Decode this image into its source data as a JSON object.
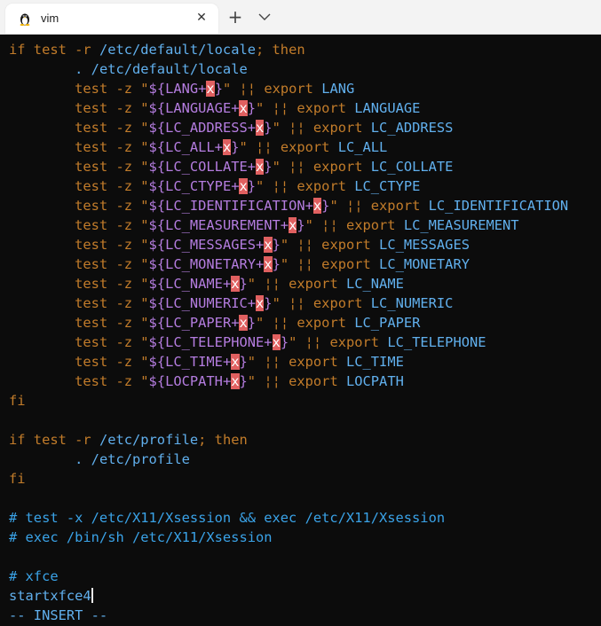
{
  "tab": {
    "title": "vim",
    "icon": "linux-tux-icon",
    "close": "✕",
    "new": "+"
  },
  "lines": [
    [
      [
        "kw",
        "if test -r "
      ],
      [
        "id",
        "/etc/default/locale"
      ],
      [
        "kw",
        "; then"
      ]
    ],
    [
      [
        "pl",
        "        "
      ],
      [
        "id",
        ". /etc/default/locale"
      ]
    ],
    [
      [
        "pl",
        "        "
      ],
      [
        "kw",
        "test -z \""
      ],
      [
        "var",
        "${LANG+"
      ],
      [
        "hl",
        "x"
      ],
      [
        "var",
        "}"
      ],
      [
        "kw",
        "\" ¦¦ export "
      ],
      [
        "id",
        "LANG"
      ]
    ],
    [
      [
        "pl",
        "        "
      ],
      [
        "kw",
        "test -z \""
      ],
      [
        "var",
        "${LANGUAGE+"
      ],
      [
        "hl",
        "x"
      ],
      [
        "var",
        "}"
      ],
      [
        "kw",
        "\" ¦¦ export "
      ],
      [
        "id",
        "LANGUAGE"
      ]
    ],
    [
      [
        "pl",
        "        "
      ],
      [
        "kw",
        "test -z \""
      ],
      [
        "var",
        "${LC_ADDRESS+"
      ],
      [
        "hl",
        "x"
      ],
      [
        "var",
        "}"
      ],
      [
        "kw",
        "\" ¦¦ export "
      ],
      [
        "id",
        "LC_ADDRESS"
      ]
    ],
    [
      [
        "pl",
        "        "
      ],
      [
        "kw",
        "test -z \""
      ],
      [
        "var",
        "${LC_ALL+"
      ],
      [
        "hl",
        "x"
      ],
      [
        "var",
        "}"
      ],
      [
        "kw",
        "\" ¦¦ export "
      ],
      [
        "id",
        "LC_ALL"
      ]
    ],
    [
      [
        "pl",
        "        "
      ],
      [
        "kw",
        "test -z \""
      ],
      [
        "var",
        "${LC_COLLATE+"
      ],
      [
        "hl",
        "x"
      ],
      [
        "var",
        "}"
      ],
      [
        "kw",
        "\" ¦¦ export "
      ],
      [
        "id",
        "LC_COLLATE"
      ]
    ],
    [
      [
        "pl",
        "        "
      ],
      [
        "kw",
        "test -z \""
      ],
      [
        "var",
        "${LC_CTYPE+"
      ],
      [
        "hl",
        "x"
      ],
      [
        "var",
        "}"
      ],
      [
        "kw",
        "\" ¦¦ export "
      ],
      [
        "id",
        "LC_CTYPE"
      ]
    ],
    [
      [
        "pl",
        "        "
      ],
      [
        "kw",
        "test -z \""
      ],
      [
        "var",
        "${LC_IDENTIFICATION+"
      ],
      [
        "hl",
        "x"
      ],
      [
        "var",
        "}"
      ],
      [
        "kw",
        "\" ¦¦ export "
      ],
      [
        "id",
        "LC_IDENTIFICATION"
      ]
    ],
    [
      [
        "pl",
        "        "
      ],
      [
        "kw",
        "test -z \""
      ],
      [
        "var",
        "${LC_MEASUREMENT+"
      ],
      [
        "hl",
        "x"
      ],
      [
        "var",
        "}"
      ],
      [
        "kw",
        "\" ¦¦ export "
      ],
      [
        "id",
        "LC_MEASUREMENT"
      ]
    ],
    [
      [
        "pl",
        "        "
      ],
      [
        "kw",
        "test -z \""
      ],
      [
        "var",
        "${LC_MESSAGES+"
      ],
      [
        "hl",
        "x"
      ],
      [
        "var",
        "}"
      ],
      [
        "kw",
        "\" ¦¦ export "
      ],
      [
        "id",
        "LC_MESSAGES"
      ]
    ],
    [
      [
        "pl",
        "        "
      ],
      [
        "kw",
        "test -z \""
      ],
      [
        "var",
        "${LC_MONETARY+"
      ],
      [
        "hl",
        "x"
      ],
      [
        "var",
        "}"
      ],
      [
        "kw",
        "\" ¦¦ export "
      ],
      [
        "id",
        "LC_MONETARY"
      ]
    ],
    [
      [
        "pl",
        "        "
      ],
      [
        "kw",
        "test -z \""
      ],
      [
        "var",
        "${LC_NAME+"
      ],
      [
        "hl",
        "x"
      ],
      [
        "var",
        "}"
      ],
      [
        "kw",
        "\" ¦¦ export "
      ],
      [
        "id",
        "LC_NAME"
      ]
    ],
    [
      [
        "pl",
        "        "
      ],
      [
        "kw",
        "test -z \""
      ],
      [
        "var",
        "${LC_NUMERIC+"
      ],
      [
        "hl",
        "x"
      ],
      [
        "var",
        "}"
      ],
      [
        "kw",
        "\" ¦¦ export "
      ],
      [
        "id",
        "LC_NUMERIC"
      ]
    ],
    [
      [
        "pl",
        "        "
      ],
      [
        "kw",
        "test -z \""
      ],
      [
        "var",
        "${LC_PAPER+"
      ],
      [
        "hl",
        "x"
      ],
      [
        "var",
        "}"
      ],
      [
        "kw",
        "\" ¦¦ export "
      ],
      [
        "id",
        "LC_PAPER"
      ]
    ],
    [
      [
        "pl",
        "        "
      ],
      [
        "kw",
        "test -z \""
      ],
      [
        "var",
        "${LC_TELEPHONE+"
      ],
      [
        "hl",
        "x"
      ],
      [
        "var",
        "}"
      ],
      [
        "kw",
        "\" ¦¦ export "
      ],
      [
        "id",
        "LC_TELEPHONE"
      ]
    ],
    [
      [
        "pl",
        "        "
      ],
      [
        "kw",
        "test -z \""
      ],
      [
        "var",
        "${LC_TIME+"
      ],
      [
        "hl",
        "x"
      ],
      [
        "var",
        "}"
      ],
      [
        "kw",
        "\" ¦¦ export "
      ],
      [
        "id",
        "LC_TIME"
      ]
    ],
    [
      [
        "pl",
        "        "
      ],
      [
        "kw",
        "test -z \""
      ],
      [
        "var",
        "${LOCPATH+"
      ],
      [
        "hl",
        "x"
      ],
      [
        "var",
        "}"
      ],
      [
        "kw",
        "\" ¦¦ export "
      ],
      [
        "id",
        "LOCPATH"
      ]
    ],
    [
      [
        "kw",
        "fi"
      ]
    ],
    [],
    [
      [
        "kw",
        "if test -r "
      ],
      [
        "id",
        "/etc/profile"
      ],
      [
        "kw",
        "; then"
      ]
    ],
    [
      [
        "pl",
        "        "
      ],
      [
        "id",
        ". /etc/profile"
      ]
    ],
    [
      [
        "kw",
        "fi"
      ]
    ],
    [],
    [
      [
        "cm",
        "# test -x /etc/X11/Xsession && exec /etc/X11/Xsession"
      ]
    ],
    [
      [
        "cm",
        "# exec /bin/sh /etc/X11/Xsession"
      ]
    ],
    [],
    [
      [
        "cm",
        "# xfce"
      ]
    ],
    [
      [
        "id",
        "startxfce4"
      ]
    ]
  ],
  "status": {
    "mode": "-- INSERT --"
  },
  "colors": {
    "keyword": "#c27c2a",
    "identifier": "#61b0ee",
    "variable": "#b57de0",
    "highlight": "#e06060",
    "comment": "#3aa3e8",
    "background": "#0c0c0c"
  }
}
